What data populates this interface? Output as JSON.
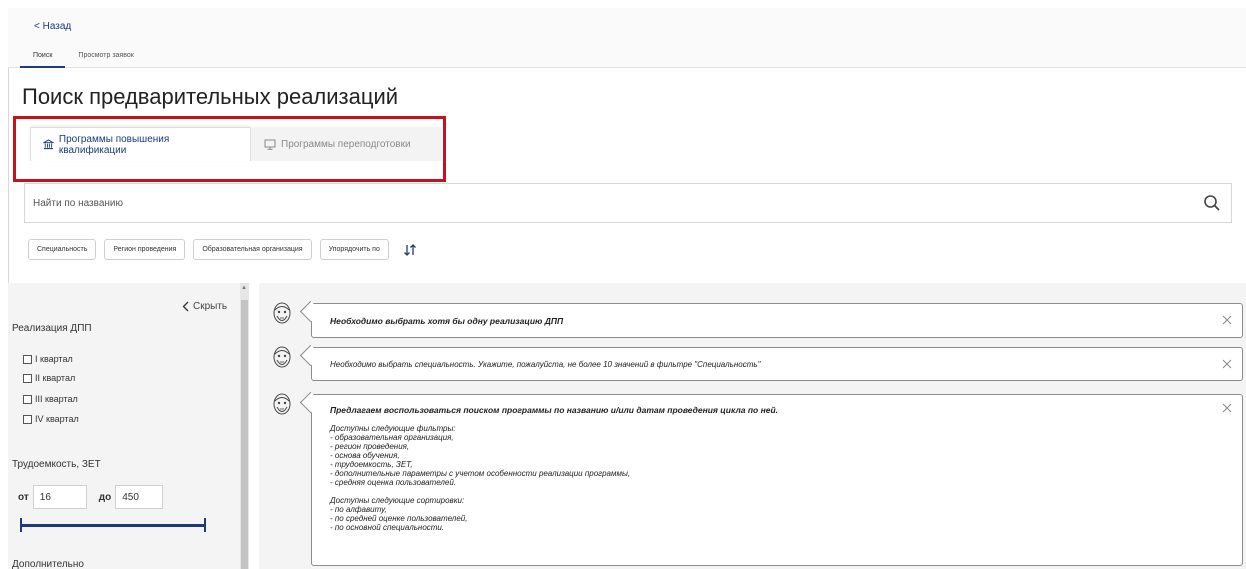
{
  "nav": {
    "back_label": "< Назад",
    "tabs": [
      {
        "label": "Поиск",
        "active": true
      },
      {
        "label": "Просмотр заявок",
        "active": false
      }
    ]
  },
  "page": {
    "title": "Поиск предварительных реализаций"
  },
  "program_tabs": [
    {
      "label": "Программы повышения квалификации",
      "icon": "institution-icon",
      "active": true
    },
    {
      "label": "Программы переподготовки",
      "icon": "monitor-icon",
      "active": false
    }
  ],
  "search": {
    "placeholder": "Найти по названию",
    "value": ""
  },
  "filters": [
    {
      "label": "Специальность"
    },
    {
      "label": "Регион проведения"
    },
    {
      "label": "Образовательная организация"
    },
    {
      "label": "Упорядочить по"
    }
  ],
  "sidebar": {
    "hide_label": "Скрыть",
    "realization_heading": "Реализация ДПП",
    "quarters": [
      "I квартал",
      "II квартал",
      "III квартал",
      "IV квартал"
    ],
    "labor_heading": "Трудоемкость, ЗЕТ",
    "range_from_label": "от",
    "range_from_value": "16",
    "range_to_label": "до",
    "range_to_value": "450",
    "extra_heading": "Дополнительно"
  },
  "messages": [
    {
      "bold": true,
      "lines": [
        "Необходимо выбрать хотя бы одну реализацию ДПП"
      ]
    },
    {
      "bold": false,
      "lines": [
        "Необходимо выбрать специальность. Укажите, пожалуйста, не более 10 значений в фильтре \"Специальность\""
      ]
    },
    {
      "bold_line": "Предлагаем воспользоваться поиском программы по названию и/или датам проведения цикла по ней.",
      "filters_title": "Доступны следующие фильтры:",
      "filters": [
        "- образовательная организация,",
        "- регион проведения,",
        "- основа обучения,",
        "- трудоемкость, ЗЕТ,",
        "- дополнительные параметры с учетом особенности реализации программы,",
        "- средняя оценка пользователей."
      ],
      "sorts_title": "Доступны следующие сортировки:",
      "sorts": [
        "- по алфавиту,",
        "- по средней оценке пользователей,",
        "- по основной специальности."
      ]
    }
  ],
  "colors": {
    "accent": "#1e3a78",
    "highlight": "#c8101e"
  }
}
